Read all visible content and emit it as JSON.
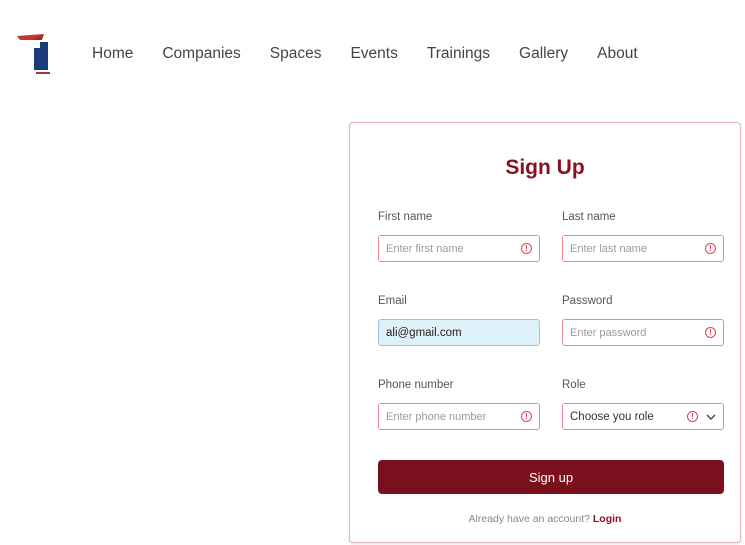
{
  "nav": {
    "items": [
      "Home",
      "Companies",
      "Spaces",
      "Events",
      "Trainings",
      "Gallery",
      "About"
    ]
  },
  "form": {
    "title": "Sign Up",
    "first_name": {
      "label": "First name",
      "placeholder": "Enter first name"
    },
    "last_name": {
      "label": "Last name",
      "placeholder": "Enter last name"
    },
    "email": {
      "label": "Email",
      "value": "ali@gmail.com"
    },
    "password": {
      "label": "Password",
      "placeholder": "Enter password"
    },
    "phone": {
      "label": "Phone number",
      "placeholder": "Enter phone number"
    },
    "role": {
      "label": "Role",
      "selected": "Choose you role"
    },
    "submit_label": "Sign up",
    "footer_text": "Already have an account?",
    "login_label": "Login"
  },
  "colors": {
    "brand": "#7a0f1d",
    "title": "#8a1024",
    "error": "#d9455a",
    "input_filled_bg": "#dff1f8"
  },
  "icons": {
    "error": "error-circle-icon",
    "dropdown": "chevron-down-icon"
  }
}
